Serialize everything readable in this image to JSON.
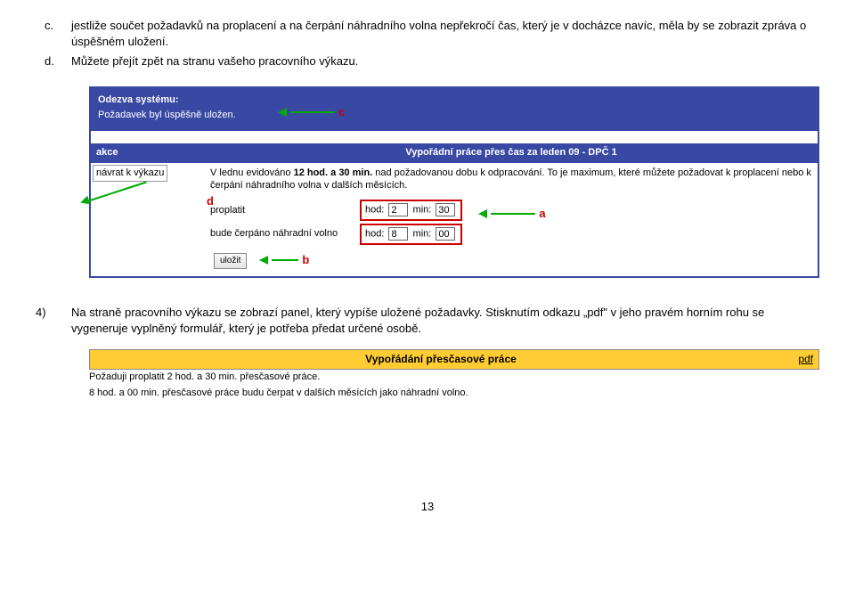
{
  "doc": {
    "item_c_marker": "c.",
    "item_c_text": "jestliže součet požadavků na proplacení a na čerpání náhradního volna nepřekročí čas, který je v docházce navíc, měla by se zobrazit zpráva o úspěšném uložení.",
    "item_d_marker": "d.",
    "item_d_text": "Můžete přejít zpět na stranu vašeho pracovního výkazu.",
    "item_4_marker": "4)",
    "item_4_text": "Na straně pracovního výkazu se zobrazí panel, který vypíše uložené požadavky. Stisknutím odkazu „pdf\" v jeho pravém horním rohu se vygeneruje vyplněný formulář, který je potřeba předat určené osobě."
  },
  "shot1": {
    "sys_title": "Odezva systému:",
    "sys_msg": "Požadavek byl úspěšně uložen.",
    "col_left_header": "akce",
    "col_right_header": "Vypořádní práce přes čas za leden 09 - DPČ 1",
    "navrat": "návrat k výkazu",
    "info_prefix": "V lednu evidováno ",
    "info_bold": "12 hod. a 30 min.",
    "info_suffix": " nad požadovanou dobu k odpracování. To je maximum, které můžete požadovat k proplacení nebo k čerpání náhradního volna v dalších měsících.",
    "prop_label1": "proplatit",
    "prop_label2": "bude čerpáno náhradní volno",
    "hod_label": "hod:",
    "min_label": "min:",
    "val_h1": "2",
    "val_m1": "30",
    "val_h2": "8",
    "val_m2": "00",
    "ulozit": "uložit",
    "a": "a",
    "b": "b",
    "c": "c",
    "d": "d"
  },
  "shot2": {
    "header_title": "Vypořádání přesčasové práce",
    "pdf": "pdf",
    "line1": "Požaduji proplatit 2 hod. a 30 min. přesčasové práce.",
    "line2": "8 hod. a 00 min. přesčasové práce budu čerpat v dalších měsících jako náhradní volno."
  },
  "page_number": "13"
}
